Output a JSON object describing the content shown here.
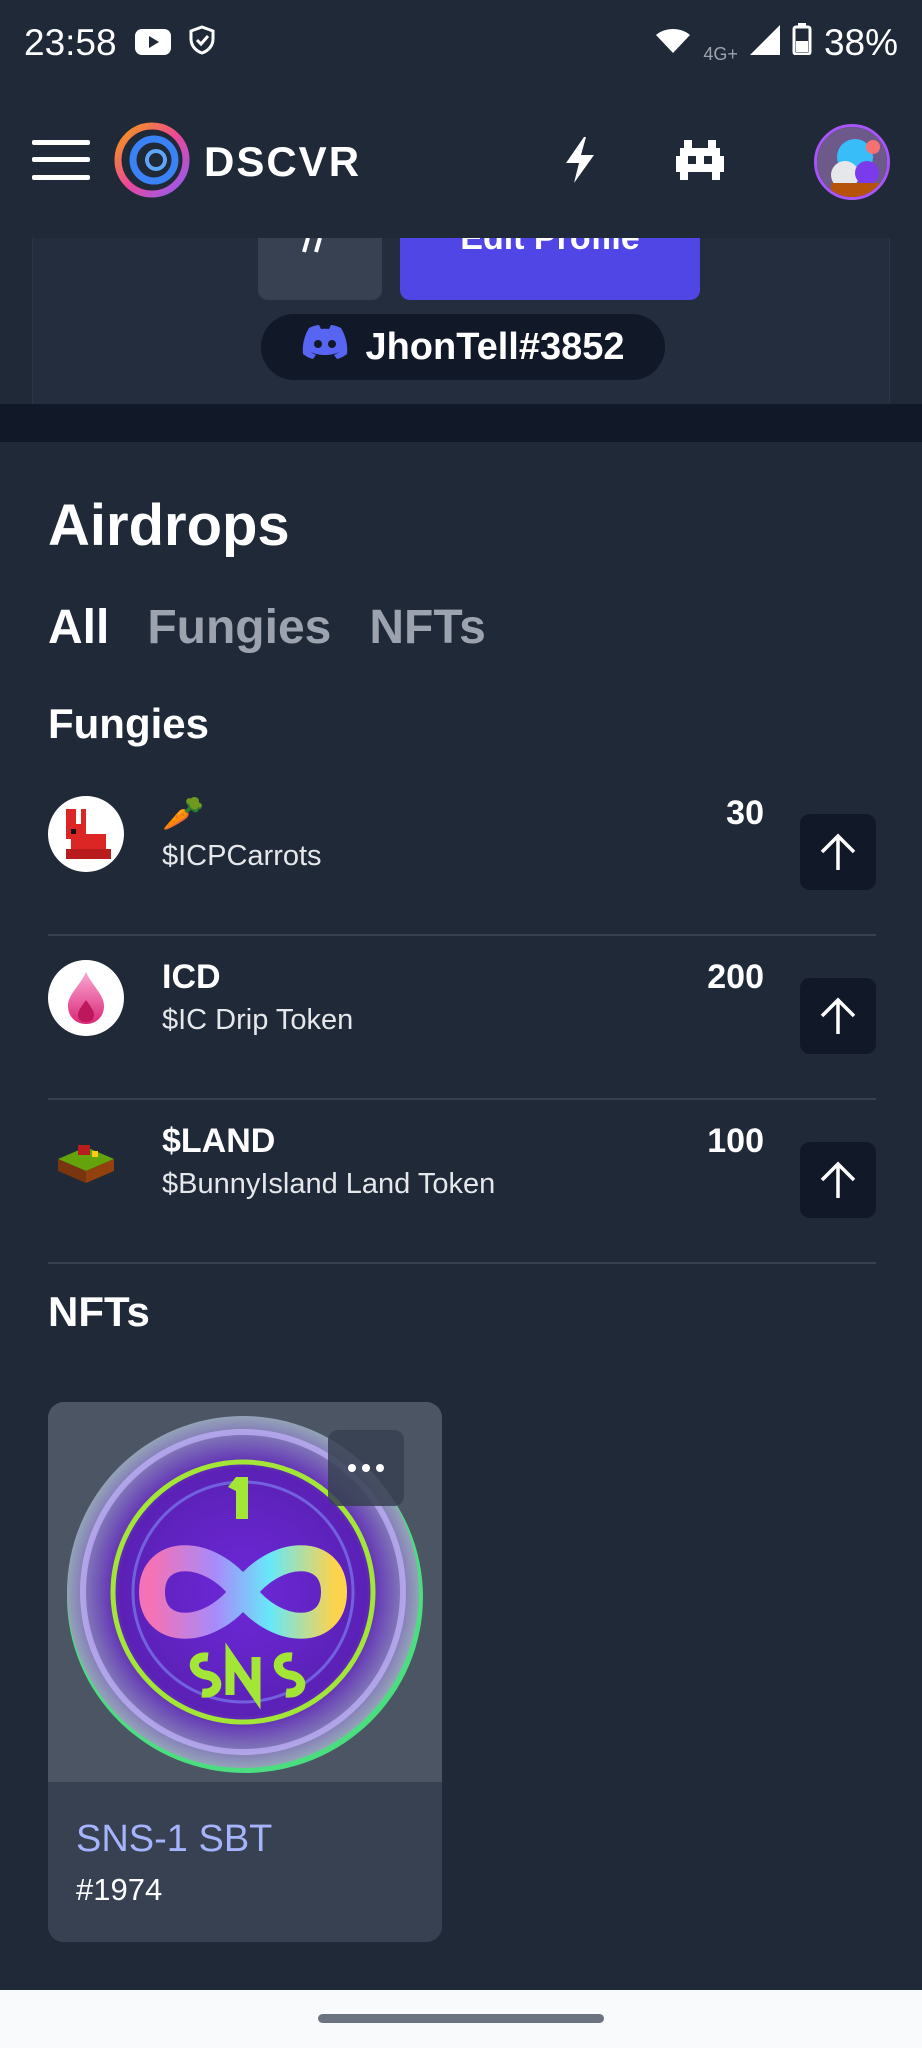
{
  "status_bar": {
    "time": "23:58",
    "network": "4G+",
    "battery": "38%",
    "icons": [
      "youtube-icon",
      "shield-icon",
      "wifi-icon",
      "signal-icon",
      "battery-icon"
    ]
  },
  "navbar": {
    "brand": "DSCVR",
    "icons": [
      "menu-icon",
      "lightning-icon",
      "space-invader-icon"
    ]
  },
  "profile": {
    "edit_label": "Edit Profile",
    "discord_handle": "JhonTell#3852"
  },
  "airdrops": {
    "title": "Airdrops",
    "tabs": [
      {
        "label": "All",
        "active": true
      },
      {
        "label": "Fungies",
        "active": false
      },
      {
        "label": "NFTs",
        "active": false
      }
    ],
    "fungies_heading": "Fungies",
    "tokens": [
      {
        "name": "🥕",
        "subtitle": "$ICPCarrots",
        "amount": "30",
        "icon": "rabbit-icon"
      },
      {
        "name": "ICD",
        "subtitle": "$IC Drip Token",
        "amount": "200",
        "icon": "drip-icon"
      },
      {
        "name": "$LAND",
        "subtitle": "$BunnyIsland Land Token",
        "amount": "100",
        "icon": "land-icon"
      }
    ],
    "nfts_heading": "NFTs",
    "nfts": [
      {
        "title": "SNS-1 SBT",
        "id": "#1974",
        "coin_number": "1",
        "coin_text": "SNS"
      }
    ]
  },
  "colors": {
    "background": "#1f2937",
    "accent": "#4f46e5",
    "discord": "#5865f2",
    "nft_title": "#a5b4fc"
  }
}
